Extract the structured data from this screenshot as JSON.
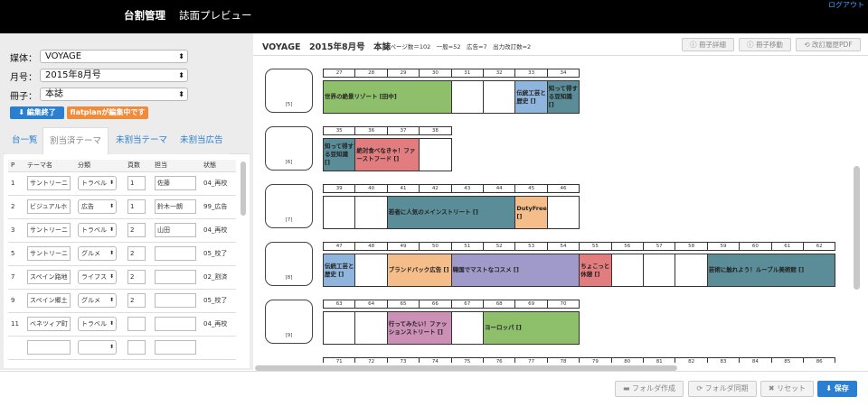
{
  "nav": {
    "tabs": [
      "台割管理",
      "誌面プレビュー"
    ],
    "logout": "ログアウト"
  },
  "controls": {
    "media_label": "媒体：",
    "media_value": "VOYAGE",
    "issue_label": "月号：",
    "issue_value": "2015年8月号",
    "book_label": "冊子：",
    "book_value": "本誌",
    "finish_label": "編集終了",
    "editing_label": "flatplanが編集中です"
  },
  "left_tabs": [
    "台一覧",
    "割当済テーマ",
    "未割当テーマ",
    "未割当広告"
  ],
  "table": {
    "headers": [
      "P",
      "テーマ名",
      "分類",
      "頁数",
      "担当",
      "状態"
    ],
    "rows": [
      [
        "1",
        "サントリーニ",
        "トラベル",
        "1",
        "佐藤",
        "04_再校"
      ],
      [
        "2",
        "ビジュアルホ",
        "広告",
        "1",
        "鈴木一朗",
        "99_広告"
      ],
      [
        "3",
        "サントリーニ",
        "トラベル",
        "2",
        "山田",
        "04_再校"
      ],
      [
        "5",
        "サントリーニ",
        "グルメ",
        "2",
        "",
        "05_校了"
      ],
      [
        "7",
        "スペイン路地",
        "ライフス",
        "2",
        "",
        "02_割済"
      ],
      [
        "9",
        "スペイン郷土",
        "グルメ",
        "2",
        "",
        "05_校了"
      ],
      [
        "11",
        "ベネツィア町",
        "トラベル",
        "",
        "",
        "04_再校"
      ],
      [
        "",
        "",
        "",
        "",
        "",
        ""
      ]
    ]
  },
  "header": {
    "title": "VOYAGE　2015年8月号　本誌",
    "stats": "総ページ数＝102　一般=52　広告=7　出力改訂数=2",
    "buttons": [
      "冊子詳細",
      "冊子移動",
      "改訂履歴PDF"
    ]
  },
  "spreads": [
    {
      "label": "[5]",
      "pages": [
        "27",
        "28",
        "29",
        "30",
        "31",
        "32",
        "33",
        "34"
      ],
      "blocks": [
        {
          "text": "世界の絶景リゾート [田中]",
          "start": 0,
          "span": 4,
          "color": "#8ebf6b"
        },
        {
          "text": "",
          "start": 4,
          "span": 1,
          "color": ""
        },
        {
          "text": "",
          "start": 5,
          "span": 1,
          "color": ""
        },
        {
          "text": "伝統工芸と歴史 []",
          "start": 6,
          "span": 1,
          "color": "#8fb5dd"
        },
        {
          "text": "知って得する豆知識 []",
          "start": 7,
          "span": 1,
          "color": "#5a8d97"
        }
      ]
    },
    {
      "label": "[6]",
      "pages": [
        "35",
        "36",
        "37",
        "38"
      ],
      "blocks": [
        {
          "text": "知って得する豆知識 []",
          "start": 0,
          "span": 1,
          "color": "#5a8d97"
        },
        {
          "text": "絶対食べなきゃ！ファーストフード []",
          "start": 1,
          "span": 2,
          "color": "#e27d7f"
        },
        {
          "text": "",
          "start": 3,
          "span": 1,
          "color": ""
        }
      ]
    },
    {
      "label": "[7]",
      "pages": [
        "39",
        "40",
        "41",
        "42",
        "43",
        "44",
        "45",
        "46"
      ],
      "blocks": [
        {
          "text": "",
          "start": 0,
          "span": 1,
          "color": ""
        },
        {
          "text": "",
          "start": 1,
          "span": 1,
          "color": ""
        },
        {
          "text": "若者に人気のメインストリート []",
          "start": 2,
          "span": 4,
          "color": "#5a8d97"
        },
        {
          "text": "DutyFree []",
          "start": 6,
          "span": 1,
          "color": "#f4bd8a"
        },
        {
          "text": "",
          "start": 7,
          "span": 1,
          "color": ""
        }
      ]
    },
    {
      "label": "[8]",
      "pages": [
        "47",
        "48",
        "49",
        "50",
        "51",
        "52",
        "53",
        "54",
        "55",
        "56",
        "57",
        "58",
        "59",
        "60",
        "61",
        "62"
      ],
      "blocks": [
        {
          "text": "伝統工芸と歴史 []",
          "start": 0,
          "span": 1,
          "color": "#8fb5dd"
        },
        {
          "text": "",
          "start": 1,
          "span": 1,
          "color": ""
        },
        {
          "text": "ブランドバック広告 []",
          "start": 2,
          "span": 2,
          "color": "#f4bd8a"
        },
        {
          "text": "韓国でマストなコスメ []",
          "start": 4,
          "span": 4,
          "color": "#a09acb"
        },
        {
          "text": "ちょこっと休憩 []",
          "start": 8,
          "span": 1,
          "color": "#e27d7f"
        },
        {
          "text": "",
          "start": 9,
          "span": 1,
          "color": ""
        },
        {
          "text": "",
          "start": 10,
          "span": 1,
          "color": ""
        },
        {
          "text": "",
          "start": 11,
          "span": 1,
          "color": ""
        },
        {
          "text": "芸術に触れよう！ルーブル美術館 []",
          "start": 12,
          "span": 4,
          "color": "#5a8d97"
        }
      ]
    },
    {
      "label": "[9]",
      "pages": [
        "63",
        "64",
        "65",
        "66",
        "67",
        "68",
        "69",
        "70"
      ],
      "blocks": [
        {
          "text": "",
          "start": 0,
          "span": 1,
          "color": ""
        },
        {
          "text": "",
          "start": 1,
          "span": 1,
          "color": ""
        },
        {
          "text": "行ってみたい！ファッションストリート []",
          "start": 2,
          "span": 2,
          "color": "#cc8fb6"
        },
        {
          "text": "",
          "start": 4,
          "span": 1,
          "color": ""
        },
        {
          "text": "ヨーロッパ []",
          "start": 5,
          "span": 3,
          "color": "#8ebf6b"
        }
      ]
    },
    {
      "label": "",
      "pages": [
        "71",
        "72",
        "73",
        "74",
        "75",
        "76",
        "77",
        "78",
        "79",
        "80",
        "81",
        "82",
        "83",
        "84",
        "85",
        "86"
      ],
      "blocks": []
    }
  ],
  "footer": {
    "buttons": [
      "フォルダ作成",
      "フォルダ同期",
      "リセット",
      "保存"
    ]
  }
}
